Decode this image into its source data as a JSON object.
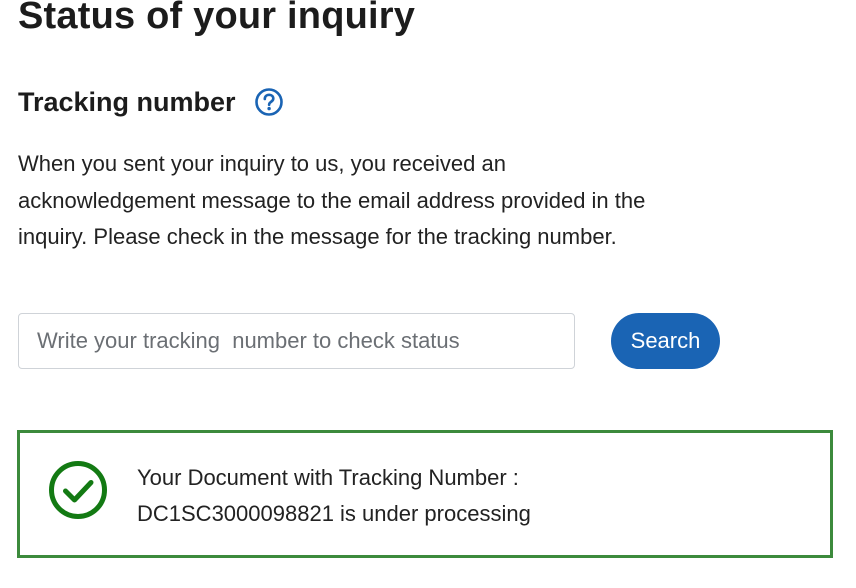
{
  "page": {
    "title": "Status of your inquiry"
  },
  "tracking": {
    "heading": "Tracking number",
    "help_icon": "question-circle-icon",
    "description": "When you sent your inquiry to us, you received an acknowledgement message to the email address provided in the inquiry. Please check in the message for the tracking number.",
    "input": {
      "placeholder": "Write your tracking  number to check status",
      "value": ""
    },
    "search_label": "Search"
  },
  "status": {
    "icon": "check-circle-icon",
    "line1": "Your Document with Tracking Number :",
    "line2": "DC1SC3000098821 is under processing",
    "border_color": "#3c8a3c",
    "icon_color": "#137a13"
  },
  "colors": {
    "accent": "#1a64b4",
    "text": "#222222"
  }
}
